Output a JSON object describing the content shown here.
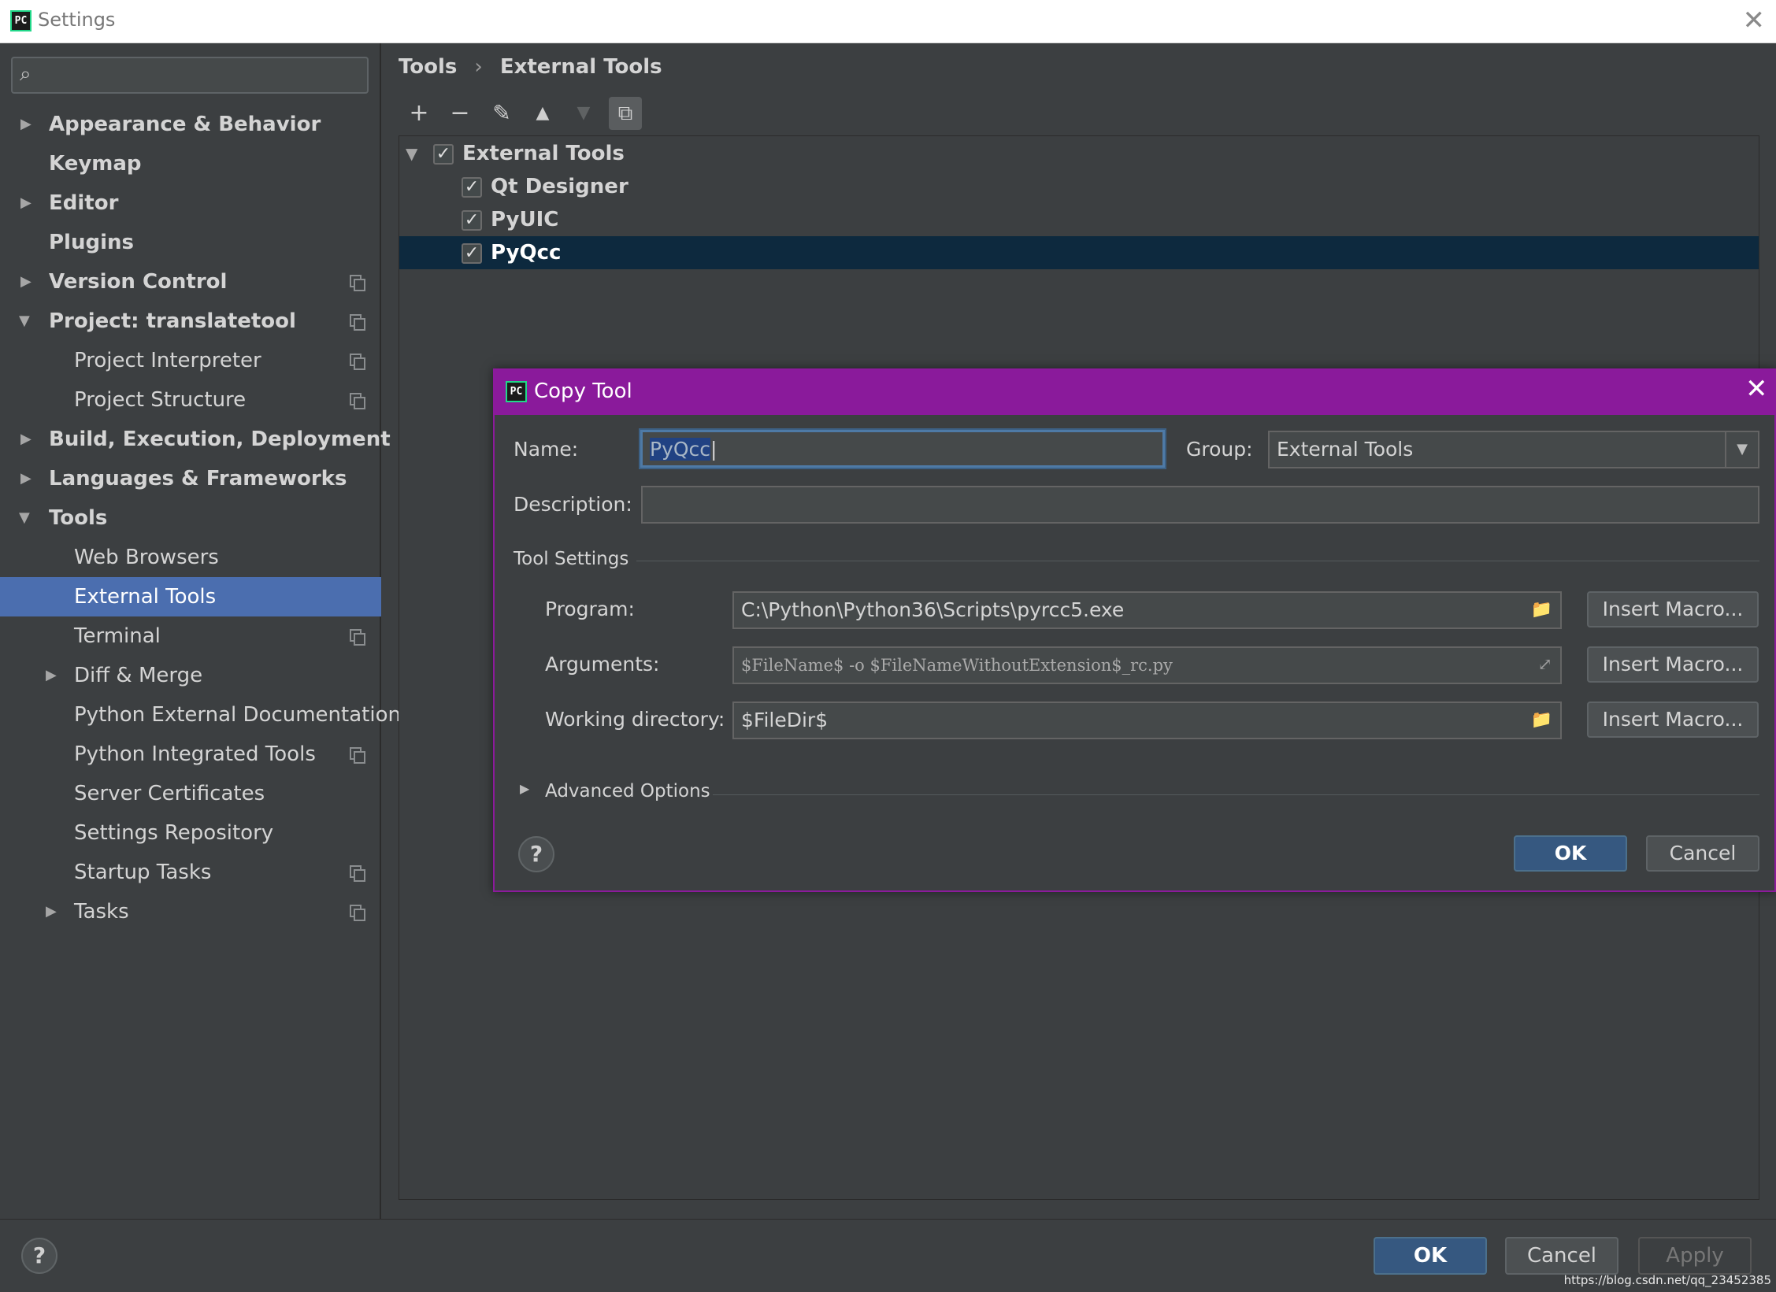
{
  "window": {
    "title": "Settings",
    "app_icon_text": "PC"
  },
  "sidebar": {
    "search_placeholder": "",
    "items": [
      {
        "label": "Appearance & Behavior"
      },
      {
        "label": "Keymap"
      },
      {
        "label": "Editor"
      },
      {
        "label": "Plugins"
      },
      {
        "label": "Version Control"
      },
      {
        "label": "Project: translatetool"
      },
      {
        "label": "Project Interpreter"
      },
      {
        "label": "Project Structure"
      },
      {
        "label": "Build, Execution, Deployment"
      },
      {
        "label": "Languages & Frameworks"
      },
      {
        "label": "Tools"
      },
      {
        "label": "Web Browsers"
      },
      {
        "label": "External Tools"
      },
      {
        "label": "Terminal"
      },
      {
        "label": "Diff & Merge"
      },
      {
        "label": "Python External Documentation"
      },
      {
        "label": "Python Integrated Tools"
      },
      {
        "label": "Server Certificates"
      },
      {
        "label": "Settings Repository"
      },
      {
        "label": "Startup Tasks"
      },
      {
        "label": "Tasks"
      }
    ]
  },
  "breadcrumb": {
    "parent": "Tools",
    "separator": "›",
    "current": "External Tools"
  },
  "toolbar": {
    "add": "+",
    "remove": "−",
    "edit": "✎",
    "up": "▲",
    "down": "▼",
    "copy": "⧉"
  },
  "tools_tree": {
    "group": {
      "label": "External Tools",
      "checked": true
    },
    "items": [
      {
        "label": "Qt Designer",
        "checked": true
      },
      {
        "label": "PyUIC",
        "checked": true
      },
      {
        "label": "PyQcc",
        "checked": true
      }
    ]
  },
  "dialog": {
    "title": "Copy Tool",
    "name_label": "Name:",
    "name_value": "PyQcc",
    "group_label": "Group:",
    "group_value": "External Tools",
    "description_label": "Description:",
    "description_value": "",
    "tool_settings_label": "Tool Settings",
    "program_label": "Program:",
    "program_value": "C:\\Python\\Python36\\Scripts\\pyrcc5.exe",
    "arguments_label": "Arguments:",
    "arguments_value": "$FileName$ -o $FileNameWithoutExtension$_rc.py",
    "workdir_label": "Working directory:",
    "workdir_value": "$FileDir$",
    "insert_macro": "Insert Macro...",
    "advanced_label": "Advanced Options",
    "help": "?",
    "ok": "OK",
    "cancel": "Cancel"
  },
  "footer": {
    "help": "?",
    "ok": "OK",
    "cancel": "Cancel",
    "apply": "Apply"
  },
  "watermark": "https://blog.csdn.net/qq_23452385",
  "colors": {
    "accent": "#4b6eaf",
    "dialog_title": "#8a1a9b",
    "selection": "#0d293e",
    "primary_button": "#365880"
  }
}
